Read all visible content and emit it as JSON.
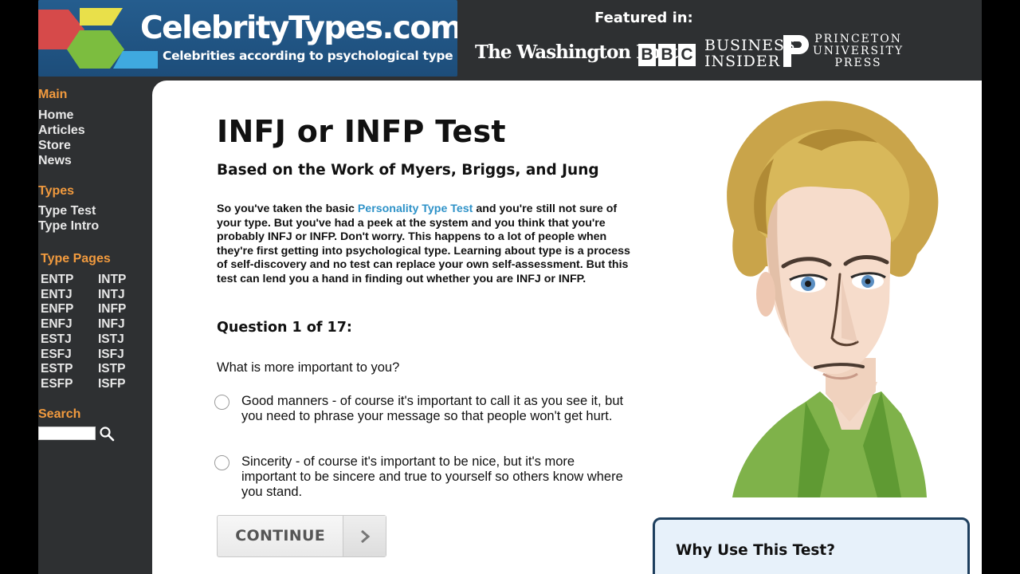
{
  "header": {
    "logo_title": "CelebrityTypes.com",
    "logo_subtitle": "Celebrities according to psychological type",
    "featured_label": "Featured in:",
    "publications": {
      "washington_post": "The Washington Post",
      "bbc": [
        "B",
        "B",
        "C"
      ],
      "business_insider": [
        "BUSINESS",
        "INSIDER"
      ],
      "princeton": [
        "PRINCETON",
        "UNIVERSITY",
        "PRESS"
      ]
    }
  },
  "sidebar": {
    "main_title": "Main",
    "main_links": [
      "Home",
      "Articles",
      "Store",
      "News"
    ],
    "types_title": "Types",
    "types_links": [
      "Type Test",
      "Type Intro"
    ],
    "type_pages_title": "Type Pages",
    "type_pages": [
      [
        "ENTP",
        "INTP"
      ],
      [
        "ENTJ",
        "INTJ"
      ],
      [
        "ENFP",
        "INFP"
      ],
      [
        "ENFJ",
        "INFJ"
      ],
      [
        "ESTJ",
        "ISTJ"
      ],
      [
        "ESFJ",
        "ISFJ"
      ],
      [
        "ESTP",
        "ISTP"
      ],
      [
        "ESFP",
        "ISFP"
      ]
    ],
    "search_title": "Search",
    "search_value": ""
  },
  "main": {
    "title": "INFJ or INFP Test",
    "subtitle": "Based on the Work of Myers, Briggs, and Jung",
    "intro_before_link": "So you've taken the basic ",
    "intro_link": "Personality Type Test",
    "intro_after_link": " and you're still not sure of your type. But you've had a peek at the system and you think that you're probably INFJ or INFP. Don't worry. This happens to a lot of people when they're first getting into psychological type. Learning about type is a process of self-discovery and no test can replace your own self-assessment. But this test can lend you a hand in finding out whether you are INFJ or INFP.",
    "question_number": "Question 1 of 17:",
    "question": "What is more important to you?",
    "options": [
      "Good manners - of course it's important to call it as you see it, but you need to phrase your message so that people won't get hurt.",
      "Sincerity - of course it's important to be nice, but it's more important to be sincere and true to yourself so others know where you stand."
    ],
    "continue_label": "CONTINUE",
    "why_title": "Why Use This Test?"
  },
  "colors": {
    "sidebar_bg": "#2e3032",
    "section_title": "#f19a3e",
    "link_blue": "#2e92c8",
    "logo_blue": "#255d8e",
    "why_box_bg": "#e7f1fa",
    "why_box_border": "#1e3f5e"
  }
}
